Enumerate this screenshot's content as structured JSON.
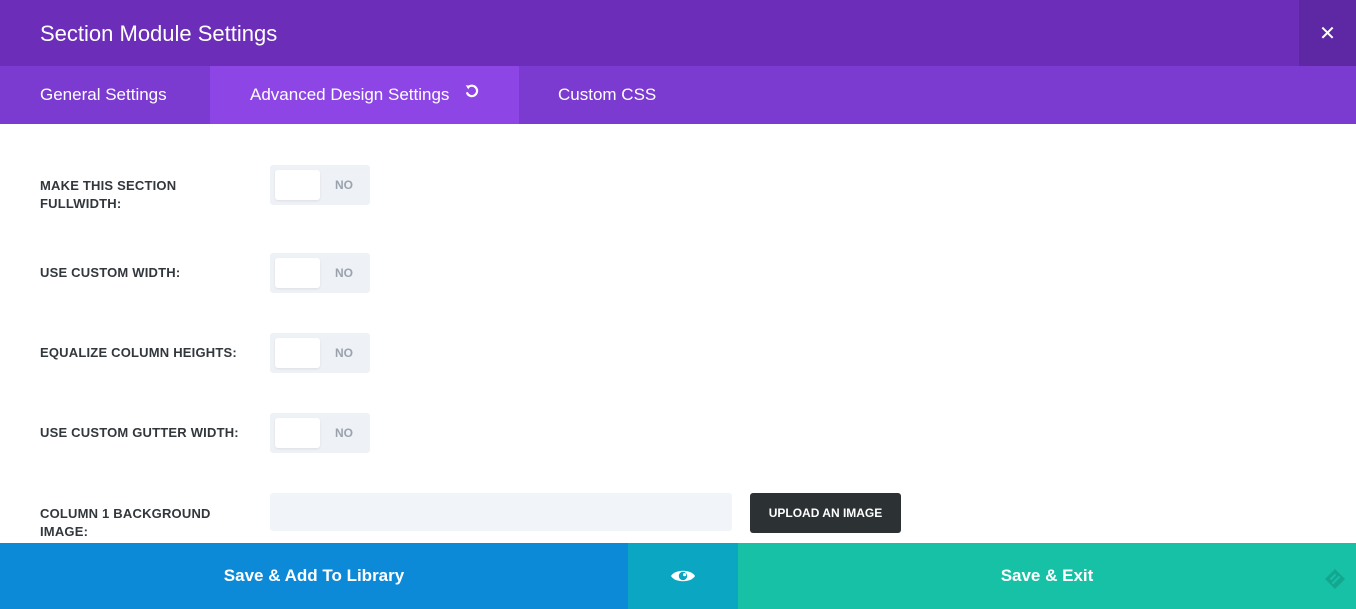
{
  "header": {
    "title": "Section Module Settings",
    "close_glyph": "✕",
    "close_icon": "close-icon"
  },
  "tabs": [
    {
      "label": "General Settings",
      "active": false
    },
    {
      "label": "Advanced Design Settings",
      "active": true,
      "icon": "reset-icon"
    },
    {
      "label": "Custom CSS",
      "active": false
    }
  ],
  "settings": [
    {
      "label": "Make this section fullwidth:",
      "value": "NO"
    },
    {
      "label": "Use Custom Width:",
      "value": "NO"
    },
    {
      "label": "Equalize Column Heights:",
      "value": "NO"
    },
    {
      "label": "Use Custom Gutter Width:",
      "value": "NO"
    }
  ],
  "column_bg": {
    "label": "Column 1 Background Image:",
    "input_value": "",
    "upload_label": "Upload an image"
  },
  "footer": {
    "save_library_label": "Save & Add To Library",
    "preview_icon": "eye-icon",
    "save_exit_label": "Save & Exit",
    "corner_icon": "expand-icon"
  },
  "colors": {
    "header_bg": "#6c2eb9",
    "tabs_bg": "#7b3ad0",
    "active_tab_bg": "#8d46e5",
    "library_btn_bg": "#0c8ad8",
    "preview_btn_bg": "#0aa6c2",
    "exit_btn_bg": "#17c1a5",
    "upload_btn_bg": "#2c3134"
  }
}
